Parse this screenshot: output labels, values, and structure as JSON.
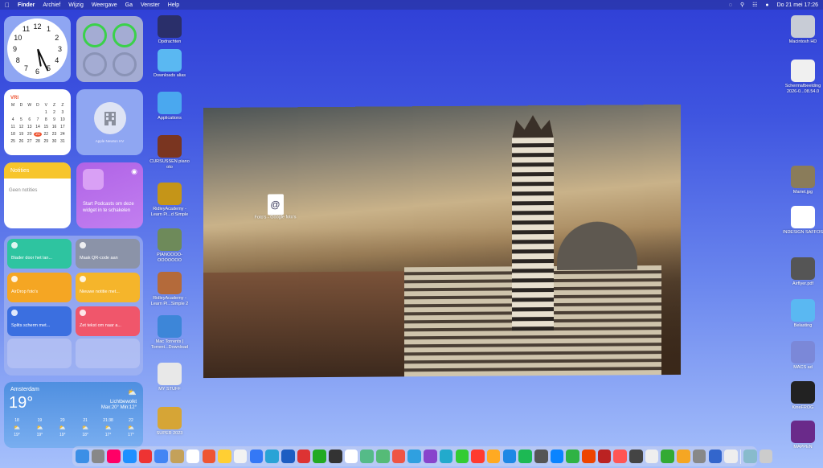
{
  "menubar": {
    "items": [
      "Finder",
      "Archief",
      "Wijzig",
      "Weergave",
      "Ga",
      "Venster",
      "Help"
    ],
    "datetime": "Do 21 mei  17:26"
  },
  "clock": {
    "numbers": [
      "11",
      "12",
      "1",
      "2",
      "3",
      "4",
      "5",
      "6",
      "7",
      "8",
      "9",
      "10"
    ]
  },
  "calendar": {
    "month": "VRI",
    "weekdays": [
      "M",
      "D",
      "W",
      "D",
      "V",
      "Z",
      "Z"
    ],
    "days": [
      "",
      "",
      "",
      "",
      "1",
      "2",
      "3",
      "4",
      "5",
      "6",
      "7",
      "8",
      "9",
      "10",
      "11",
      "12",
      "13",
      "14",
      "15",
      "16",
      "17",
      "18",
      "19",
      "20",
      "21",
      "22",
      "23",
      "24",
      "25",
      "26",
      "27",
      "28",
      "29",
      "30",
      "31"
    ],
    "today": "21"
  },
  "building_widget": {
    "label": "Apple Newton HV"
  },
  "notes": {
    "title": "Notities",
    "body": "Geen notities"
  },
  "podcasts": {
    "text": "Start Podcasts om deze widget in te schakelen"
  },
  "shortcuts": [
    {
      "label": "Blader door het lan...",
      "color": "#2ec4a0"
    },
    {
      "label": "Maak QR-code aan",
      "color": "#8b93a8"
    },
    {
      "label": "AirDrop foto's",
      "color": "#f5a623"
    },
    {
      "label": "Nieuwe notitie met...",
      "color": "#f5b52b"
    },
    {
      "label": "Splits scherm met...",
      "color": "#3b6fe0"
    },
    {
      "label": "Zet tekst om naar a...",
      "color": "#f0566b"
    }
  ],
  "weather": {
    "city": "Amsterdam",
    "temp": "19°",
    "condition": "Lichtbewolkt",
    "range": "Max:20° Min:12°",
    "hours": [
      {
        "h": "18",
        "t": "19°"
      },
      {
        "h": "19",
        "t": "19°"
      },
      {
        "h": "20",
        "t": "19°"
      },
      {
        "h": "21",
        "t": "18°"
      },
      {
        "h": "21:38",
        "t": "17°"
      },
      {
        "h": "22",
        "t": "17°"
      }
    ]
  },
  "desk_left": [
    {
      "label": "Opdrachten",
      "color": "#2a2f6a"
    },
    {
      "label": "Downloads alias",
      "color": "#5ab8f2"
    },
    {
      "label": "Applications",
      "color": "#4aa8ef"
    },
    {
      "label": "CURSUSSEN piano oto",
      "color": "#7a3520"
    },
    {
      "label": "RidleyAcademy - Learn Pi...d Simple",
      "color": "#c59518"
    },
    {
      "label": "PIANOOOO-OOOOOOO",
      "color": "#6e8a5a"
    },
    {
      "label": "RidleyAcademy - Learn Pi...Simple 2",
      "color": "#b46a3a"
    },
    {
      "label": "Mac Torrents | Torrent...Download",
      "color": "#3d86d8"
    },
    {
      "label": "MY STUFF",
      "color": "#e8e8e8"
    },
    {
      "label": "SUPER 2023",
      "color": "#d6a536"
    }
  ],
  "desk_right": [
    {
      "label": "Macintosh HD",
      "color": "#c8ccd6"
    },
    {
      "label": "Schermafbeelding 2026-0...08.54.0",
      "color": "#f0f0f0"
    },
    {
      "label": "Mariet.jpg",
      "color": "#8a7c5a"
    },
    {
      "label": "INDESIGN SAFFOS",
      "color": "#ffffff"
    },
    {
      "label": "Airflyer.pdf",
      "color": "#555"
    },
    {
      "label": "Belasting",
      "color": "#5ab8f2"
    },
    {
      "label": "MACS ad",
      "color": "#7b88d8"
    },
    {
      "label": "KineFROG",
      "color": "#222"
    },
    {
      "label": "MAPPEN",
      "color": "#6a2a8a"
    }
  ],
  "photo_file": {
    "label": "Foto's - Google foto's"
  },
  "dock_apps": [
    "#3b8fe6",
    "#888",
    "#f06",
    "#1e90ff",
    "#e33",
    "#4285f4",
    "#c4a15a",
    "#fff",
    "#e53",
    "#ffcf33",
    "#f2f2f2",
    "#3478f6",
    "#29a3d6",
    "#1d5dc2",
    "#d33",
    "#2a2",
    "#333",
    "#fff",
    "#5b8",
    "#5b7",
    "#e54",
    "#2fa0e0",
    "#8844cc",
    "#2ac",
    "#3c3",
    "#ff3b30",
    "#fa2",
    "#1e88e5",
    "#1db954",
    "#555",
    "#0a84ff",
    "#2fb344",
    "#e40",
    "#b22",
    "#ff5555",
    "#444",
    "#eee",
    "#3a3",
    "#f5a623",
    "#888",
    "#36c",
    "#eee",
    "#8bc",
    "#ccc"
  ]
}
